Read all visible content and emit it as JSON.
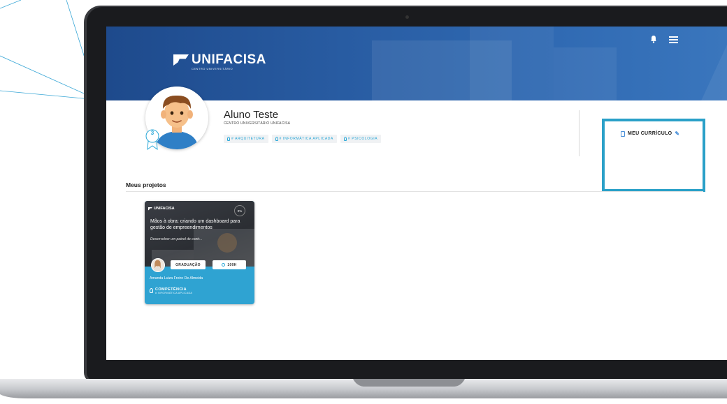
{
  "app": {
    "logo_text": "UNIFACISA",
    "logo_subtitle": "CENTRO UNIVERSITÁRIO",
    "card_logo_text": "UNIFACISA"
  },
  "profile": {
    "name": "Aluno Teste",
    "institution": "CENTRO UNIVERSITÁRIO UNIFACISA",
    "level_badge": "3",
    "chips": [
      {
        "label": "# ARQUITETURA"
      },
      {
        "label": "# INFORMÁTICA APLICADA"
      },
      {
        "label": "# PSICOLOGIA"
      }
    ]
  },
  "curriculo": {
    "label": "MEU CURRÍCULO"
  },
  "projects": {
    "section_title": "Meus projetos",
    "items": [
      {
        "progress": "0%",
        "title": "Mãos à obra: criando um dashboard para gestão de empreendimentos",
        "description": "Desenvolver um painel de contr...",
        "level": "GRADUAÇÃO",
        "hours": "100H",
        "author": "Amanda Luiza Freire De Almeida",
        "competency_title": "COMPETÊNCIA",
        "competency_tag": "# INFORMÁTICA APLICADA"
      }
    ]
  },
  "colors": {
    "banner": "#2a5fa6",
    "accent": "#2aa8d8",
    "highlight": "#2aa0c8",
    "card": "#2fa3d2"
  },
  "icons": [
    "bell-icon",
    "menu-icon",
    "document-icon",
    "pencil-icon",
    "lightbulb-icon",
    "clock-icon"
  ]
}
